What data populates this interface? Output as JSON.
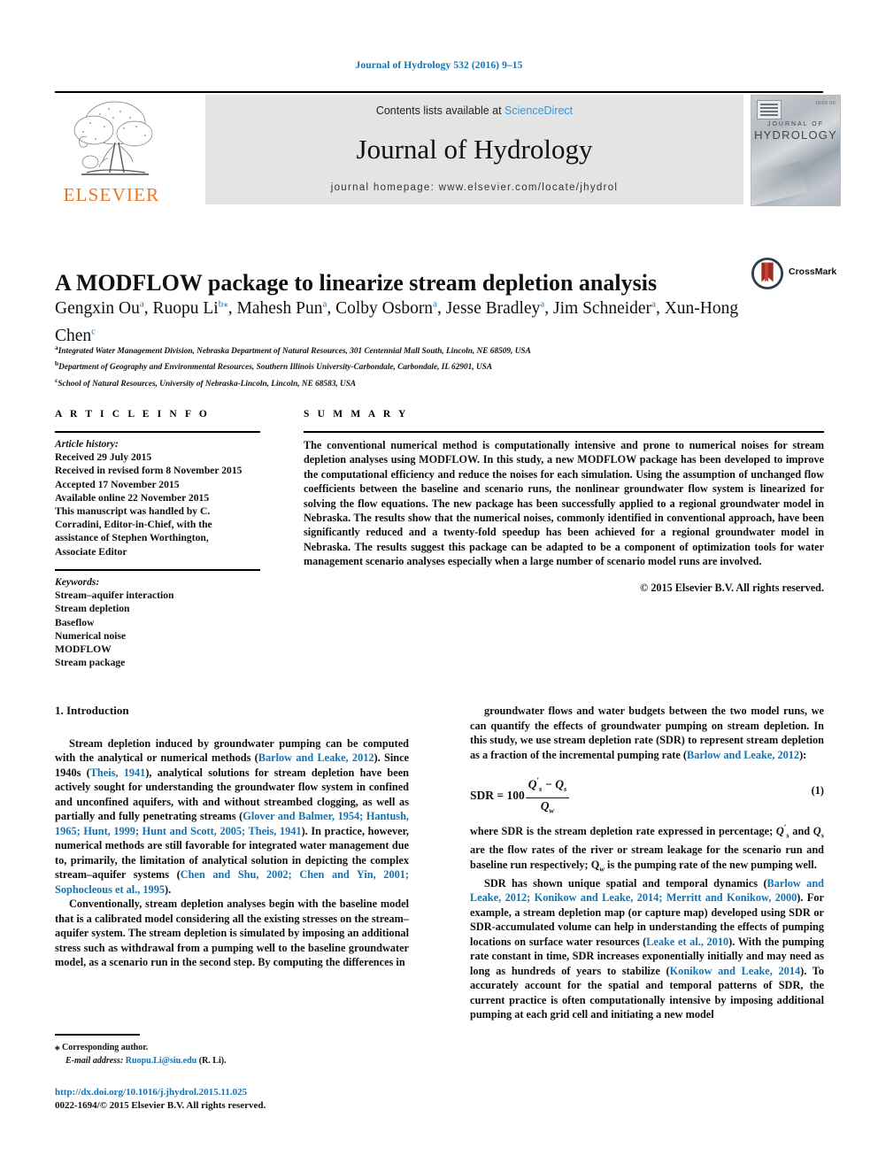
{
  "running_head": "Journal of Hydrology 532 (2016) 9–15",
  "masthead": {
    "elsevier_wordmark": "ELSEVIER",
    "contents_prefix": "Contents lists available at ",
    "sciencedirect": "ScienceDirect",
    "journal_name": "Journal of Hydrology",
    "homepage": "journal homepage: www.elsevier.com/locate/jhydrol",
    "cover": {
      "line1": "JOURNAL OF",
      "line2": "HYDROLOGY",
      "issn": "ISSN 00"
    },
    "colors": {
      "link_blue": "#1673b1",
      "sciencedirect_blue": "#3a97d4",
      "elsevier_orange": "#e87722",
      "band_gray": "#e4e4e4"
    }
  },
  "article": {
    "title": "A MODFLOW package to linearize stream depletion analysis",
    "authors": [
      {
        "name": "Gengxin Ou",
        "marks": "a"
      },
      {
        "name": "Ruopu Li",
        "marks": "b",
        "star": true
      },
      {
        "name": "Mahesh Pun",
        "marks": "a"
      },
      {
        "name": "Colby Osborn",
        "marks": "a"
      },
      {
        "name": "Jesse Bradley",
        "marks": "a"
      },
      {
        "name": "Jim Schneider",
        "marks": "a"
      },
      {
        "name": "Xun-Hong Chen",
        "marks": "c"
      }
    ],
    "affiliations": [
      {
        "mark": "a",
        "text": "Integrated Water Management Division, Nebraska Department of Natural Resources, 301 Centennial Mall South, Lincoln, NE 68509, USA"
      },
      {
        "mark": "b",
        "text": "Department of Geography and Environmental Resources, Southern Illinois University-Carbondale, Carbondale, IL 62901, USA"
      },
      {
        "mark": "c",
        "text": "School of Natural Resources, University of Nebraska-Lincoln, Lincoln, NE 68583, USA"
      }
    ],
    "crossmark_label": "CrossMark"
  },
  "info": {
    "heading": "A R T I C L E    I N F O",
    "history_label": "Article history:",
    "history": [
      "Received 29 July 2015",
      "Received in revised form 8 November 2015",
      "Accepted 17 November 2015",
      "Available online 22 November 2015",
      "This manuscript was handled by C.",
      "Corradini, Editor-in-Chief, with the",
      "assistance of Stephen Worthington,",
      "Associate Editor"
    ],
    "keywords_label": "Keywords:",
    "keywords": [
      "Stream–aquifer interaction",
      "Stream depletion",
      "Baseflow",
      "Numerical noise",
      "MODFLOW",
      "Stream package"
    ]
  },
  "summary": {
    "heading": "S U M M A R Y",
    "text": "The conventional numerical method is computationally intensive and prone to numerical noises for stream depletion analyses using MODFLOW. In this study, a new MODFLOW package has been developed to improve the computational efficiency and reduce the noises for each simulation. Using the assumption of unchanged flow coefficients between the baseline and scenario runs, the nonlinear groundwater flow system is linearized for solving the flow equations. The new package has been successfully applied to a regional groundwater model in Nebraska. The results show that the numerical noises, commonly identified in conventional approach, have been significantly reduced and a twenty-fold speedup has been achieved for a regional groundwater model in Nebraska. The results suggest this package can be adapted to be a component of optimization tools for water management scenario analyses especially when a large number of scenario model runs are involved.",
    "copyright": "© 2015 Elsevier B.V. All rights reserved."
  },
  "body": {
    "section_heading": "1. Introduction",
    "left_p1_a": "Stream depletion induced by groundwater pumping can be computed with the analytical or numerical methods (",
    "left_p1_ref1": "Barlow and Leake, 2012",
    "left_p1_b": "). Since 1940s (",
    "left_p1_ref2": "Theis, 1941",
    "left_p1_c": "), analytical solutions for stream depletion have been actively sought for understanding the groundwater flow system in confined and unconfined aquifers, with and without streambed clogging, as well as partially and fully penetrating streams (",
    "left_p1_ref3": "Glover and Balmer, 1954; Hantush, 1965; Hunt, 1999; Hunt and Scott, 2005; Theis, 1941",
    "left_p1_d": "). In practice, however, numerical methods are still favorable for integrated water management due to, primarily, the limitation of analytical solution in depicting the complex stream–aquifer systems (",
    "left_p1_ref4": "Chen and Shu, 2002; Chen and Yin, 2001; Sophocleous et al., 1995",
    "left_p1_e": ").",
    "left_p2": "Conventionally, stream depletion analyses begin with the baseline model that is a calibrated model considering all the existing stresses on the stream–aquifer system. The stream depletion is simulated by imposing an additional stress such as withdrawal from a pumping well to the baseline groundwater model, as a scenario run in the second step. By computing the differences in",
    "right_p1_a": "groundwater flows and water budgets between the two model runs, we can quantify the effects of groundwater pumping on stream depletion. In this study, we use stream depletion rate (SDR) to represent stream depletion as a fraction of the incremental pumping rate (",
    "right_p1_ref1": "Barlow and Leake, 2012",
    "right_p1_b": "):",
    "equation": {
      "lhs": "SDR",
      "equals": "=",
      "coefficient": "100",
      "numerator": "Q′s − Qs",
      "denominator": "Qw",
      "number": "(1)"
    },
    "right_p2_a": "where SDR is the stream depletion rate expressed in percentage; ",
    "right_p2_b": " and ",
    "right_p2_c": " are the flow rates of the river or stream leakage for the scenario run and baseline run respectively; ",
    "right_p2_d": " is the pumping rate of the new pumping well.",
    "right_p3_a": "SDR has shown unique spatial and temporal dynamics (",
    "right_p3_ref1": "Barlow and Leake, 2012; Konikow and Leake, 2014; Merritt and Konikow, 2000",
    "right_p3_b": "). For example, a stream depletion map (or capture map) developed using SDR or SDR-accumulated volume can help in understanding the effects of pumping locations on surface water resources (",
    "right_p3_ref2": "Leake et al., 2010",
    "right_p3_c": "). With the pumping rate constant in time, SDR increases exponentially initially and may need as long as hundreds of years to stabilize (",
    "right_p3_ref3": "Konikow and Leake, 2014",
    "right_p3_d": "). To accurately account for the spatial and temporal patterns of SDR, the current practice is often computationally intensive by imposing additional pumping at each grid cell and initiating a new model"
  },
  "footnote": {
    "star": "⁎",
    "corresponding": "Corresponding author.",
    "email_label": "E-mail address:",
    "email": "Ruopu.Li@siu.edu",
    "email_suffix": "(R. Li)."
  },
  "footer": {
    "doi": "http://dx.doi.org/10.1016/j.jhydrol.2015.11.025",
    "copyright": "0022-1694/© 2015 Elsevier B.V. All rights reserved."
  }
}
